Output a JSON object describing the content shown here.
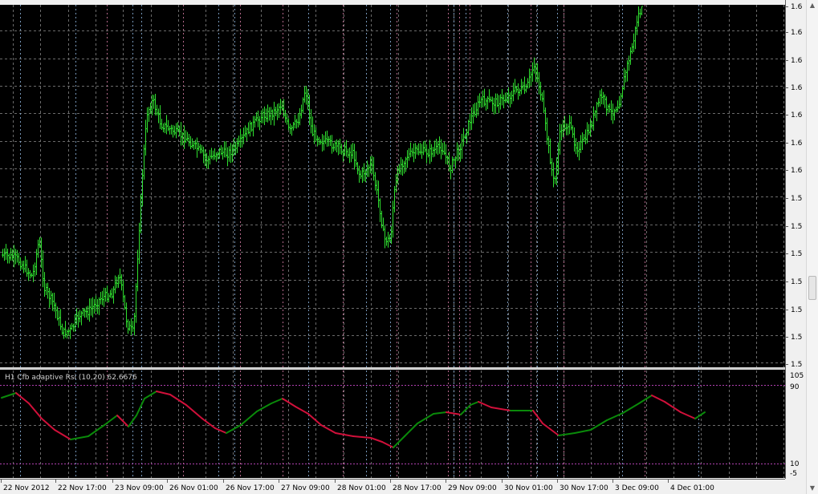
{
  "indicator": {
    "label": "H1 Cfb adaptive Rsi (10,20) 62.6676"
  },
  "price_axis": {
    "labels": [
      "1.6",
      "1.6",
      "1.6",
      "1.6",
      "1.6",
      "1.6",
      "1.6",
      "1.5",
      "1.5",
      "1.5",
      "1.5",
      "1.5",
      "1.5",
      "1.5"
    ]
  },
  "indicator_axis": {
    "labels": [
      "105",
      "90",
      "10",
      "-5"
    ]
  },
  "time_axis": {
    "labels": [
      "22 Nov 2012",
      "22 Nov 17:00",
      "23 Nov 09:00",
      "26 Nov 01:00",
      "26 Nov 17:00",
      "27 Nov 09:00",
      "28 Nov 01:00",
      "28 Nov 17:00",
      "29 Nov 09:00",
      "30 Nov 01:00",
      "30 Nov 17:00",
      "3 Dec 09:00",
      "4 Dec 01:00"
    ]
  },
  "colors": {
    "background": "#000000",
    "candle": "#2fdf2f",
    "rsi_up": "#0a8a0a",
    "rsi_down": "#d0103a",
    "grid": "#6a6a6a",
    "level_line": "#b040b0"
  },
  "scrollbar": {
    "up_icon": "▲",
    "down_icon": "▼"
  }
}
